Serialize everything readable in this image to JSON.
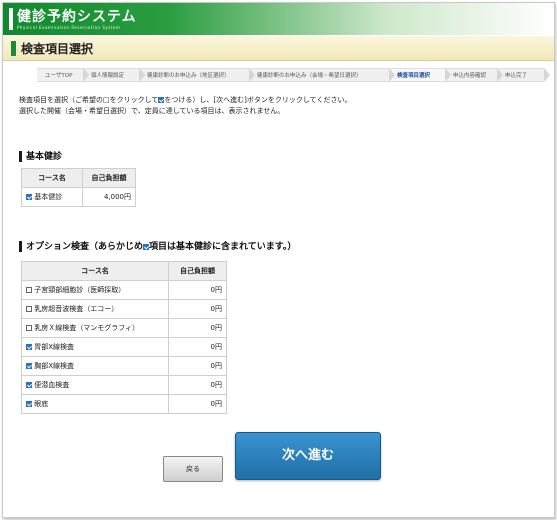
{
  "header": {
    "logo_title": "健診予約システム",
    "logo_subtitle": "Physical Examination Reservation System",
    "page_title": "検査項目選択"
  },
  "steps": [
    {
      "label": "ユーザTOP",
      "active": false
    },
    {
      "label": "個人情報設定",
      "active": false
    },
    {
      "label": "健康診断のお申込み（地区選択）",
      "active": false
    },
    {
      "label": "健康診断のお申込み（会場・希望日選択）",
      "active": false
    },
    {
      "label": "検査項目選択",
      "active": true
    },
    {
      "label": "申込内容確認",
      "active": false
    },
    {
      "label": "申込完了",
      "active": false
    }
  ],
  "instructions": {
    "line1_a": "検査項目を選択（ご希望の□をクリックして",
    "line1_b": "をつける）し、[次へ進む]ボタンをクリックしてください。",
    "line2": "選択した開催（会場・希望日選択）で、定員に達している項目は、表示されません。"
  },
  "basic": {
    "heading": "基本健診",
    "col_course": "コース名",
    "col_amount": "自己負担額",
    "rows": [
      {
        "name": "基本健診",
        "amount": "4,000円",
        "checked": true
      }
    ]
  },
  "options": {
    "heading_a": "オプション検査（あらかじめ",
    "heading_b": "項目は基本健診に含まれています。）",
    "col_course": "コース名",
    "col_amount": "自己負担額",
    "rows": [
      {
        "name": "子宮頸部細胞診（医師採取）",
        "amount": "0円",
        "checked": false
      },
      {
        "name": "乳房超音波検査（エコー）",
        "amount": "0円",
        "checked": false
      },
      {
        "name": "乳房Ｘ線検査（マンモグラフィ）",
        "amount": "0円",
        "checked": false
      },
      {
        "name": "胃部X線検査",
        "amount": "0円",
        "checked": true
      },
      {
        "name": "胸部X線検査",
        "amount": "0円",
        "checked": true
      },
      {
        "name": "便潜血検査",
        "amount": "0円",
        "checked": true
      },
      {
        "name": "眼底",
        "amount": "0円",
        "checked": true
      }
    ]
  },
  "buttons": {
    "back": "戻る",
    "next": "次へ進む"
  },
  "colors": {
    "brand_green": "#1d8a38",
    "next_button": "#2a80bd",
    "checkbox_checked": "#2f6fc4"
  }
}
